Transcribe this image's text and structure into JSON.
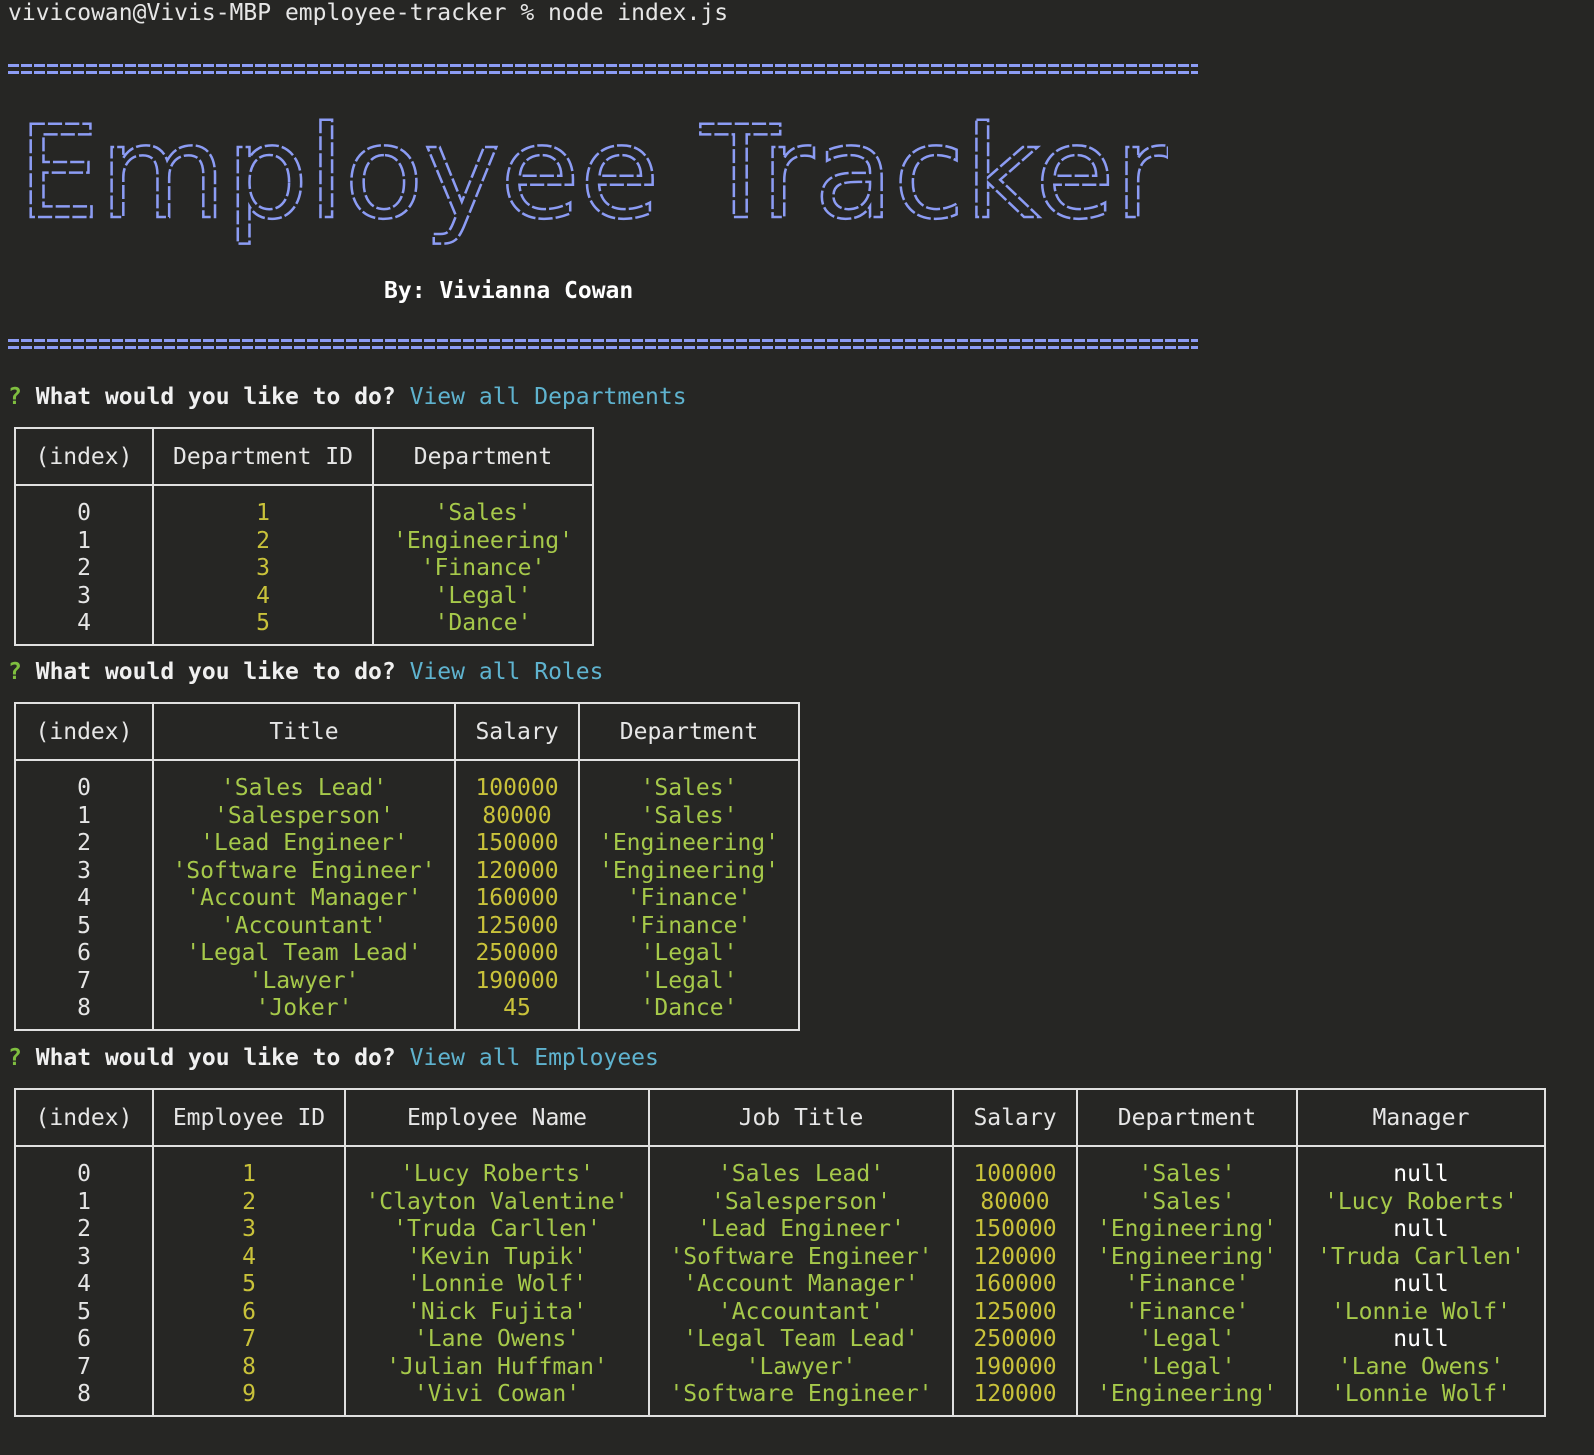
{
  "command_line": "vivicowan@Vivis-MBP employee-tracker % node index.js",
  "banner": {
    "title": "Employee Tracker",
    "byline": "By: Vivianna Cowan",
    "color": "#8c9cf4"
  },
  "prompt_question": "What would you like to do?",
  "prompt_mark": "?",
  "departments": {
    "answer": "View all Departments",
    "headers": [
      "(index)",
      "Department ID",
      "Department"
    ],
    "rows": [
      [
        "0",
        "1",
        "'Sales'"
      ],
      [
        "1",
        "2",
        "'Engineering'"
      ],
      [
        "2",
        "3",
        "'Finance'"
      ],
      [
        "3",
        "4",
        "'Legal'"
      ],
      [
        "4",
        "5",
        "'Dance'"
      ]
    ]
  },
  "roles": {
    "answer": "View all Roles",
    "headers": [
      "(index)",
      "Title",
      "Salary",
      "Department"
    ],
    "rows": [
      [
        "0",
        "'Sales Lead'",
        "100000",
        "'Sales'"
      ],
      [
        "1",
        "'Salesperson'",
        "80000",
        "'Sales'"
      ],
      [
        "2",
        "'Lead Engineer'",
        "150000",
        "'Engineering'"
      ],
      [
        "3",
        "'Software Engineer'",
        "120000",
        "'Engineering'"
      ],
      [
        "4",
        "'Account Manager'",
        "160000",
        "'Finance'"
      ],
      [
        "5",
        "'Accountant'",
        "125000",
        "'Finance'"
      ],
      [
        "6",
        "'Legal Team Lead'",
        "250000",
        "'Legal'"
      ],
      [
        "7",
        "'Lawyer'",
        "190000",
        "'Legal'"
      ],
      [
        "8",
        "'Joker'",
        "45",
        "'Dance'"
      ]
    ]
  },
  "employees": {
    "answer": "View all Employees",
    "headers": [
      "(index)",
      "Employee ID",
      "Employee Name",
      "Job Title",
      "Salary",
      "Department",
      "Manager"
    ],
    "rows": [
      [
        "0",
        "1",
        "'Lucy Roberts'",
        "'Sales Lead'",
        "100000",
        "'Sales'",
        "null"
      ],
      [
        "1",
        "2",
        "'Clayton Valentine'",
        "'Salesperson'",
        "80000",
        "'Sales'",
        "'Lucy Roberts'"
      ],
      [
        "2",
        "3",
        "'Truda Carllen'",
        "'Lead Engineer'",
        "150000",
        "'Engineering'",
        "null"
      ],
      [
        "3",
        "4",
        "'Kevin Tupik'",
        "'Software Engineer'",
        "120000",
        "'Engineering'",
        "'Truda Carllen'"
      ],
      [
        "4",
        "5",
        "'Lonnie Wolf'",
        "'Account Manager'",
        "160000",
        "'Finance'",
        "null"
      ],
      [
        "5",
        "6",
        "'Nick Fujita'",
        "'Accountant'",
        "125000",
        "'Finance'",
        "'Lonnie Wolf'"
      ],
      [
        "6",
        "7",
        "'Lane Owens'",
        "'Legal Team Lead'",
        "250000",
        "'Legal'",
        "null"
      ],
      [
        "7",
        "8",
        "'Julian Huffman'",
        "'Lawyer'",
        "190000",
        "'Legal'",
        "'Lane Owens'"
      ],
      [
        "8",
        "9",
        "'Vivi Cowan'",
        "'Software Engineer'",
        "120000",
        "'Engineering'",
        "'Lonnie Wolf'"
      ]
    ]
  }
}
